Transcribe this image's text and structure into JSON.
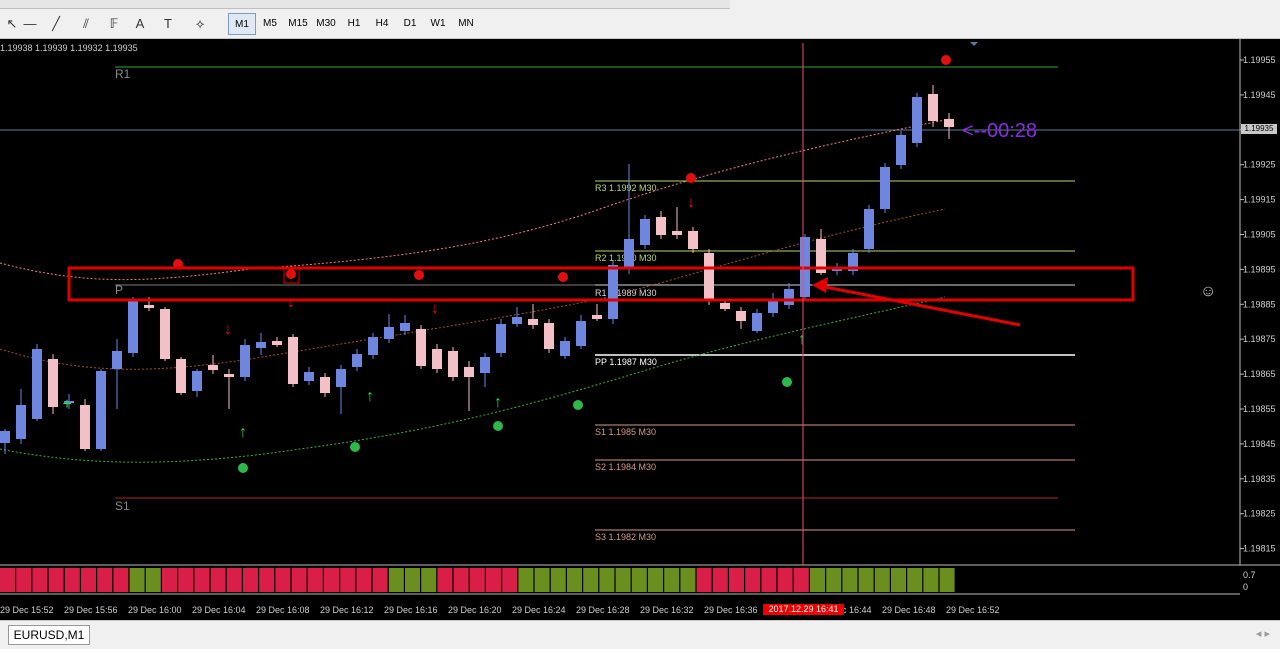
{
  "toolbar": {
    "timeframes": [
      "M1",
      "M5",
      "M15",
      "M30",
      "H1",
      "H4",
      "D1",
      "W1",
      "MN"
    ],
    "active_timeframe": "M1",
    "tools": [
      "cursor-icon",
      "vertical-line-icon",
      "diagonal-line-icon",
      "fibonacci-icon",
      "channel-icon",
      "text-icon",
      "label-icon",
      "shapes-icon"
    ]
  },
  "chart": {
    "ohlc_text": "1.19938 1.19939 1.19932 1.19935",
    "price_axis_labels": [
      "1.19955",
      "1.19945",
      "1.19935",
      "1.19925",
      "1.19915",
      "1.19905",
      "1.19895",
      "1.19885",
      "1.19875",
      "1.19865",
      "1.19855",
      "1.19845",
      "1.19835",
      "1.19825",
      "1.19815"
    ],
    "current_price": "1.19935",
    "time_labels": [
      "29 Dec 15:52",
      "29 Dec 15:56",
      "29 Dec 16:00",
      "29 Dec 16:04",
      "29 Dec 16:08",
      "29 Dec 16:12",
      "29 Dec 16:16",
      "29 Dec 16:20",
      "29 Dec 16:24",
      "29 Dec 16:28",
      "29 Dec 16:32",
      "29 Dec 16:36",
      "29 Dec 16:44",
      "29 Dec 16:48",
      "29 Dec 16:52"
    ],
    "highlighted_time": "2017.12.29 16:41",
    "countdown": "<--00:28",
    "pivot_left_labels": {
      "r1": "R1",
      "p": "P",
      "s1": "S1"
    },
    "pivot_levels": [
      {
        "label": "R3 1.1992 M30",
        "color": "#b8d86a"
      },
      {
        "label": "R2 1.1990 M30",
        "color": "#b8d86a"
      },
      {
        "label": "R1 1.1989 M30",
        "color": "#d8d8d8"
      },
      {
        "label": "PP 1.1987 M30",
        "color": "#ffffff"
      },
      {
        "label": "S1 1.1985 M30",
        "color": "#d49a8a"
      },
      {
        "label": "S2 1.1984 M30",
        "color": "#d49a8a"
      },
      {
        "label": "S3 1.1982 M30",
        "color": "#d49a8a"
      }
    ],
    "sub_window_scale": [
      "0.7",
      "0"
    ],
    "colors": {
      "bull": "#6f86e0",
      "bear": "#f4c0c8",
      "highlight": "#e00000",
      "sub_red": "#d91e48",
      "sub_green": "#6a8f1e"
    }
  },
  "tabs": {
    "active": "EURUSD,M1"
  }
}
